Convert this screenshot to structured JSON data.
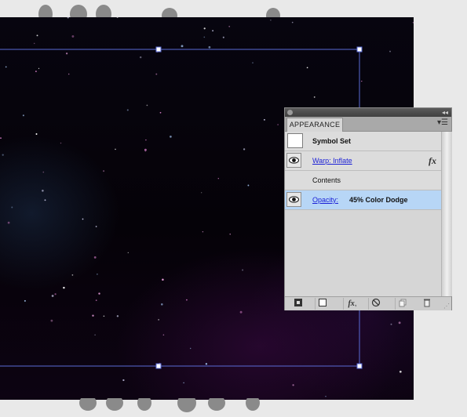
{
  "panel": {
    "tab_label": "APPEARANCE",
    "menu_icon": "panel-menu-icon",
    "collapse_glyph": "◂◂",
    "rows": [
      {
        "label": "Symbol Set"
      },
      {
        "label": "Warp: Inflate",
        "fx": "fx"
      },
      {
        "label": "Contents"
      },
      {
        "label": "Opacity:",
        "value": "45% Color Dodge"
      }
    ],
    "tools": [
      "add-new-stroke-icon",
      "add-new-fill-icon",
      "add-new-effect-icon",
      "clear-appearance-icon",
      "duplicate-item-icon",
      "delete-item-icon"
    ]
  },
  "colors": {
    "selection": "#5a6bd6",
    "highlight_row": "#b7d6f6",
    "link": "#1a1fd6"
  }
}
